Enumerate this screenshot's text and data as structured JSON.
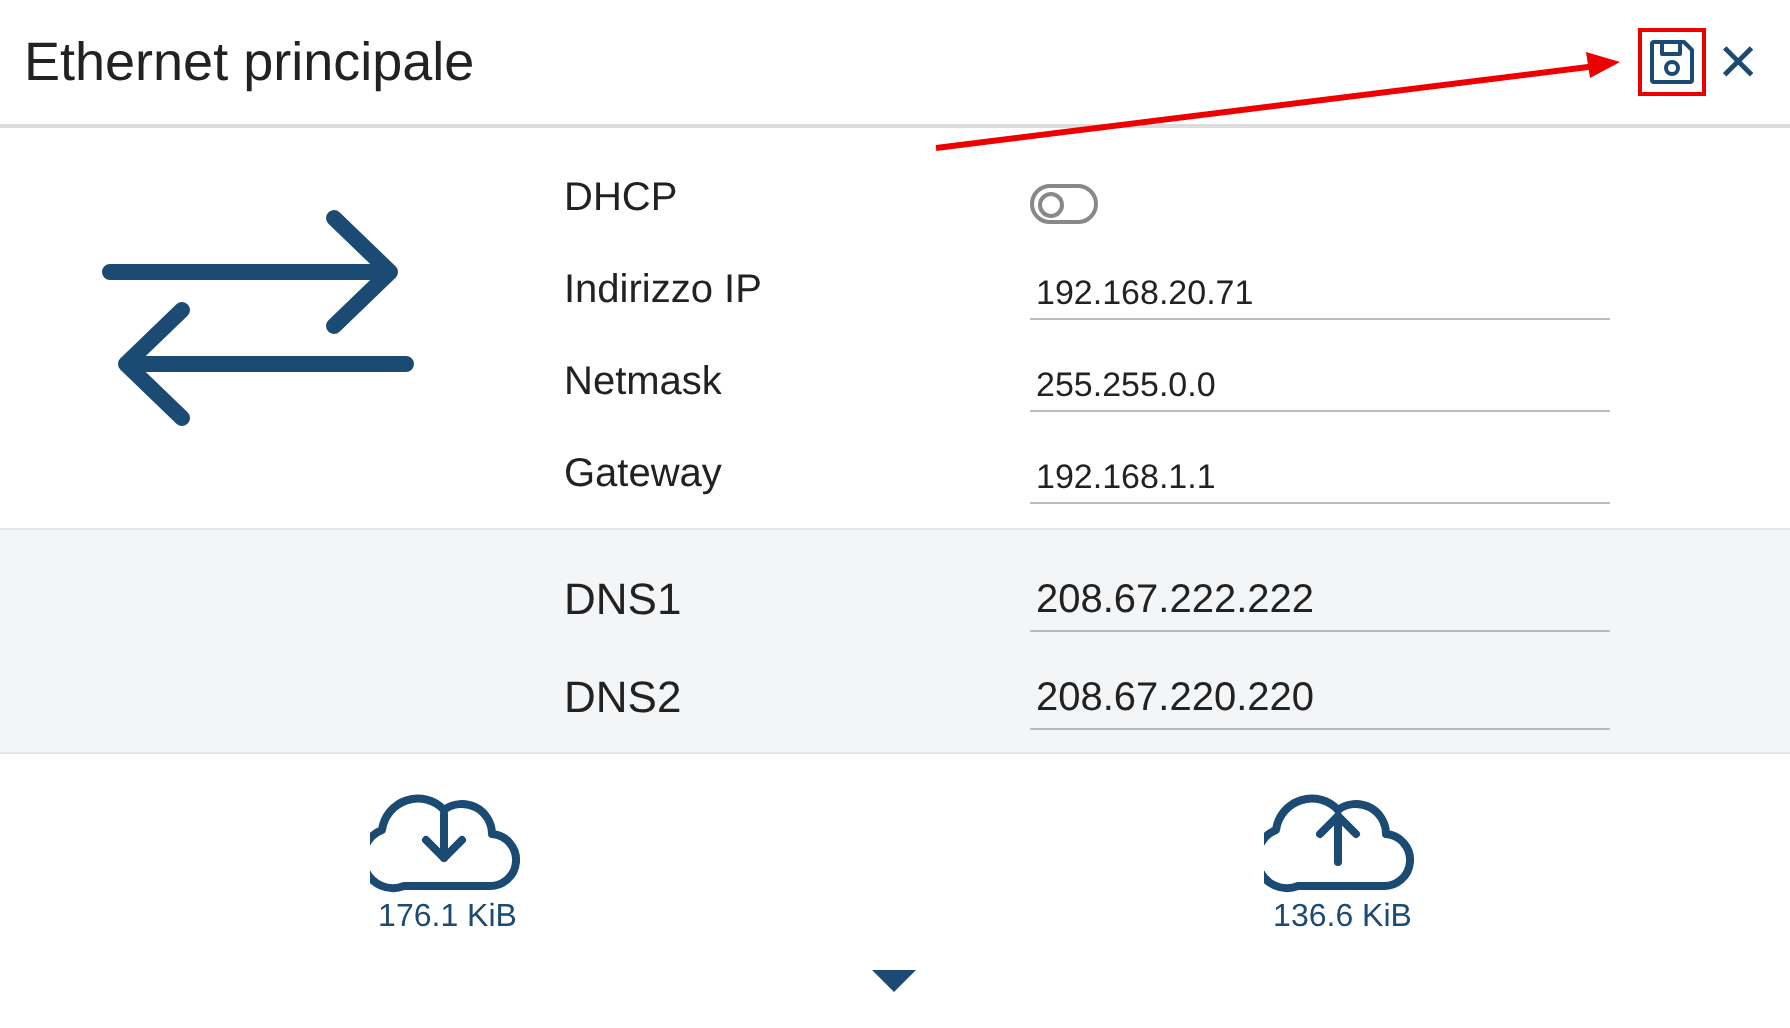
{
  "header": {
    "title": "Ethernet principale",
    "save": {
      "highlighted": true
    },
    "close": "×"
  },
  "settings": [
    {
      "kind": "toggle",
      "label": "DHCP",
      "on": false
    },
    {
      "kind": "field",
      "label": "Indirizzo IP",
      "value": "192.168.20.71"
    },
    {
      "kind": "field",
      "label": "Netmask",
      "value": "255.255.0.0"
    },
    {
      "kind": "field",
      "label": "Gateway",
      "value": "192.168.1.1"
    }
  ],
  "dns": [
    {
      "label": "DNS1",
      "value": "208.67.222.222"
    },
    {
      "label": "DNS2",
      "value": "208.67.220.220"
    }
  ],
  "traffic": [
    {
      "kind": "download",
      "amount": "176.1 KiB"
    },
    {
      "kind": "upload",
      "amount": "136.6 KiB"
    }
  ],
  "annotation": {
    "arrow_to_save": true
  }
}
